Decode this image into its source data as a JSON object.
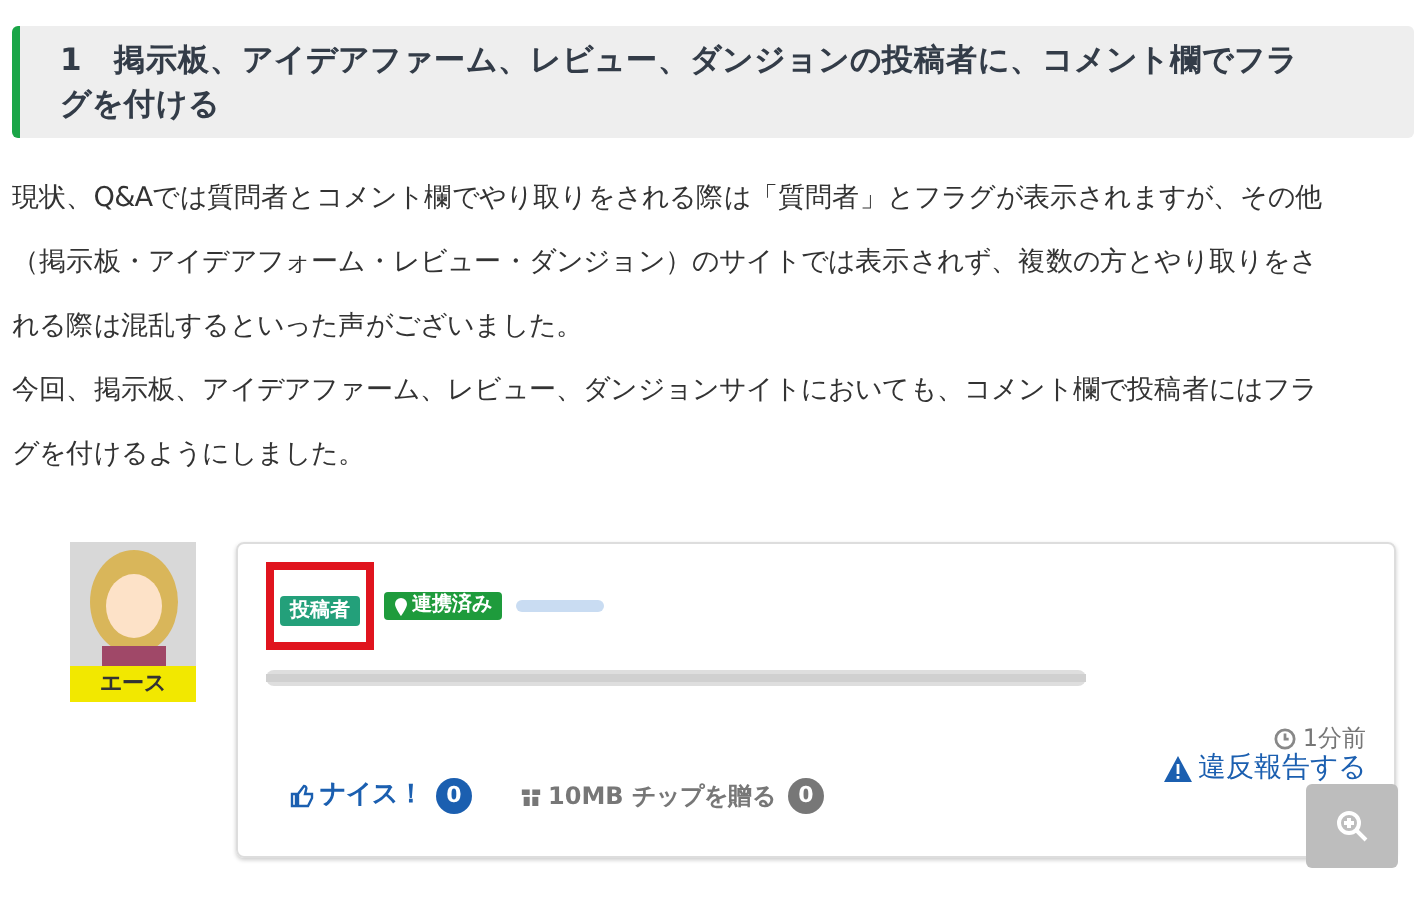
{
  "heading": {
    "number": "1",
    "text": "掲示板、アイデアファーム、レビュー、ダンジョンの投稿者に、コメント欄でフラグを付ける"
  },
  "paragraphs": [
    "現状、Q&Aでは質問者とコメント欄でやり取りをされる際は「質問者」とフラグが表示されますが、その他（掲示板・アイデアフォーム・レビュー・ダンジョン）のサイトでは表示されず、複数の方とやり取りをされる際は混乱するといった声がございました。",
    "今回、掲示板、アイデアファーム、レビュー、ダンジョンサイトにおいても、コメント欄で投稿者にはフラグを付けるようにしました。"
  ],
  "comment": {
    "rank": "エース",
    "badges": [
      {
        "kind": "poster",
        "label": "投稿者",
        "highlighted": true
      },
      {
        "kind": "linked",
        "label": "連携済み",
        "highlighted": false
      }
    ],
    "time": "1分前",
    "nice": {
      "label": "ナイス！",
      "count": "0"
    },
    "tip": {
      "label": "10MB チップを贈る",
      "count": "0"
    },
    "report": "違反報告する"
  }
}
